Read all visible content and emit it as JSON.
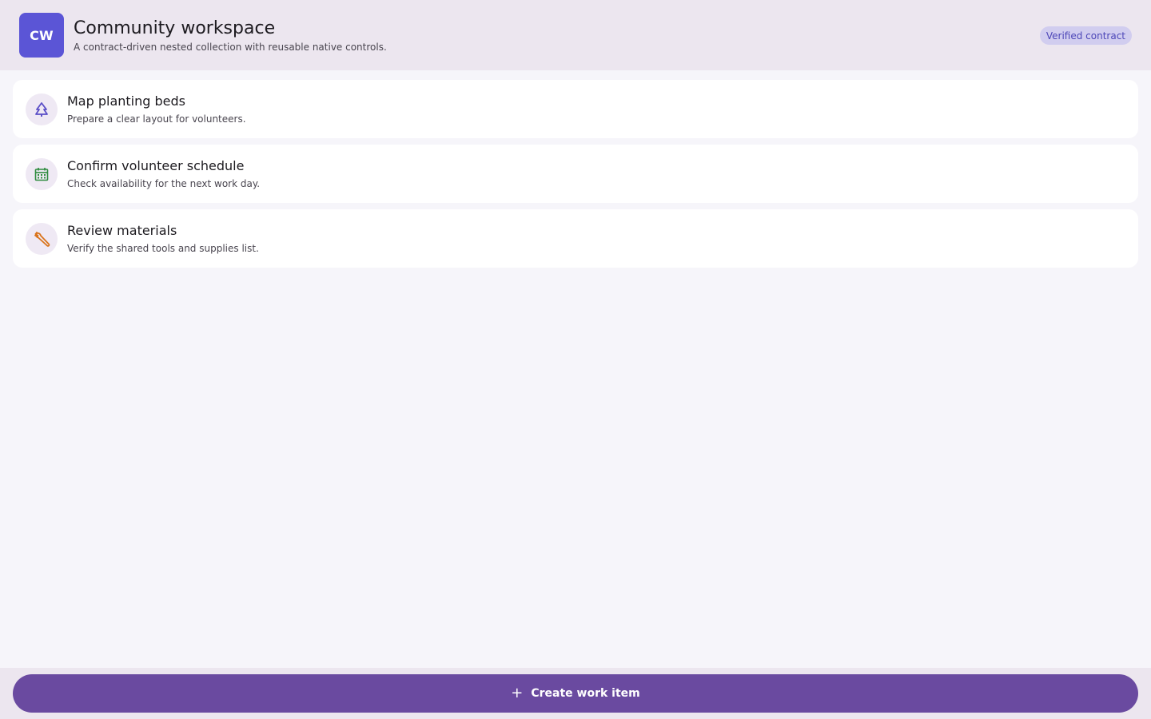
{
  "header": {
    "avatar_initials": "CW",
    "title": "Community workspace",
    "subtitle": "A contract-driven nested collection with reusable native controls.",
    "badge": "Verified contract"
  },
  "items": [
    {
      "title": "Map planting beds",
      "description": "Prepare a clear layout for volunteers.",
      "icon": "tree-icon",
      "icon_color": "#5b4fc7"
    },
    {
      "title": "Confirm volunteer schedule",
      "description": "Check availability for the next work day.",
      "icon": "calendar-icon",
      "icon_color": "#2e8b3e"
    },
    {
      "title": "Review materials",
      "description": "Verify the shared tools and supplies list.",
      "icon": "wrench-icon",
      "icon_color": "#d9731a"
    }
  ],
  "footer": {
    "create_label": "Create work item"
  },
  "colors": {
    "accent": "#6a4aa0",
    "avatar": "#5b55d6",
    "badge_bg": "#d1cdef"
  }
}
